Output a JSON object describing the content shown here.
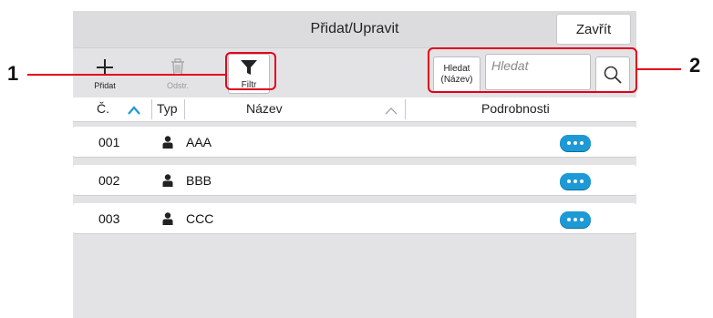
{
  "window": {
    "title": "Přidat/Upravit",
    "close_label": "Zavřít"
  },
  "toolbar": {
    "add_label": "Přidat",
    "delete_label": "Odstr.",
    "filter_label": "Filtr",
    "search_key_line1": "Hledat",
    "search_key_line2": "(Název)",
    "search_placeholder": "Hledat"
  },
  "table": {
    "columns": [
      "Č.",
      "Typ",
      "Název",
      "Podrobnosti"
    ],
    "rows": [
      {
        "number": "001",
        "type_icon": "person-icon",
        "name": "AAA"
      },
      {
        "number": "002",
        "type_icon": "person-icon",
        "name": "BBB"
      },
      {
        "number": "003",
        "type_icon": "person-icon",
        "name": "CCC"
      }
    ]
  },
  "callouts": [
    "1",
    "2"
  ],
  "colors": {
    "accent": "#1d9ad6",
    "callout": "#e3001b"
  }
}
